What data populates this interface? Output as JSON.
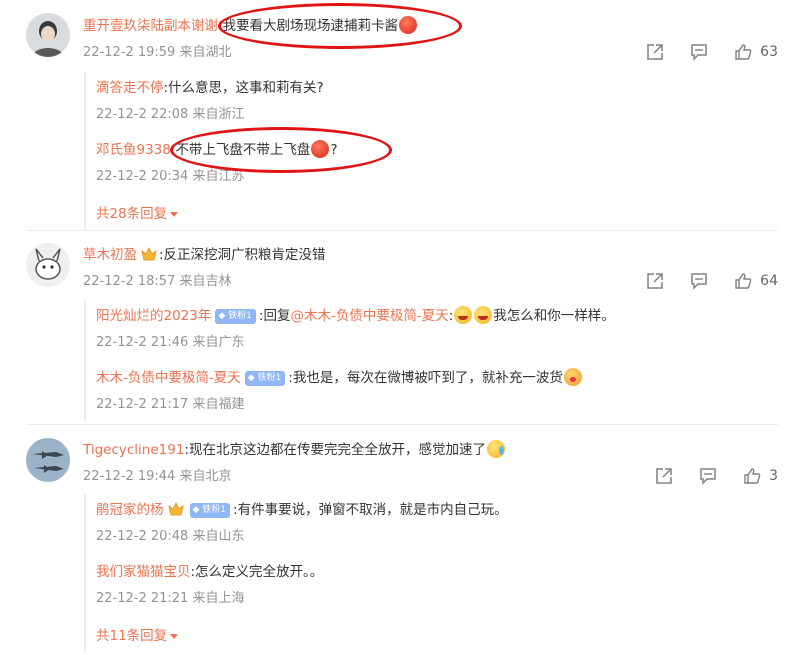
{
  "comments": [
    {
      "user": "重开壹玖柒陆副本谢谢",
      "text": ":我要看大剧场现场逮捕莉卡酱",
      "time": "22-12-2 19:59",
      "location": "来自湖北",
      "likes": "63",
      "replies": [
        {
          "user": "滴答走不停",
          "text": ":什么意思，这事和莉有关?",
          "time": "22-12-2 22:08",
          "location": "来自浙江"
        },
        {
          "user": "邓氏鱼9338",
          "text": ":不带上飞盘不带上飞盘",
          "text_tail": "?",
          "time": "22-12-2 20:34",
          "location": "来自江苏"
        }
      ],
      "more": "共28条回复"
    },
    {
      "user": "草木初盈",
      "text": ":反正深挖洞广积粮肯定没错",
      "time": "22-12-2 18:57",
      "location": "来自吉林",
      "likes": "64",
      "replies": [
        {
          "user": "阳光灿烂的2023年",
          "badge": "铁粉1",
          "text": ":回复",
          "mention": "@木木-负债中要极简-夏天",
          "text_tail": ":",
          "text_tail2": "我怎么和你一样样。",
          "time": "22-12-2 21:46",
          "location": "来自广东"
        },
        {
          "user": "木木-负债中要极简-夏天",
          "badge": "铁粉1",
          "text": ":我也是，每次在微博被吓到了，就补充一波货",
          "time": "22-12-2 21:17",
          "location": "来自福建"
        }
      ]
    },
    {
      "user": "Tigecycline191",
      "text": ":现在北京这边都在传要完完全全放开，感觉加速了",
      "time": "22-12-2 19:44",
      "location": "来自北京",
      "likes": "3",
      "replies": [
        {
          "user": "鹃冠家的杨",
          "badge": "铁粉1",
          "text": ":有件事要说，弹窗不取消，就是市内自己玩。",
          "time": "22-12-2 20:48",
          "location": "来自山东"
        },
        {
          "user": "我们家猫猫宝贝",
          "text": ":怎么定义完全放开。。",
          "time": "22-12-2 21:21",
          "location": "来自上海"
        }
      ],
      "more": "共11条回复"
    }
  ],
  "colors": {
    "name": "#eb7350",
    "meta": "#939393",
    "badge": "#8fb6f7",
    "annotation": "#e01414"
  }
}
